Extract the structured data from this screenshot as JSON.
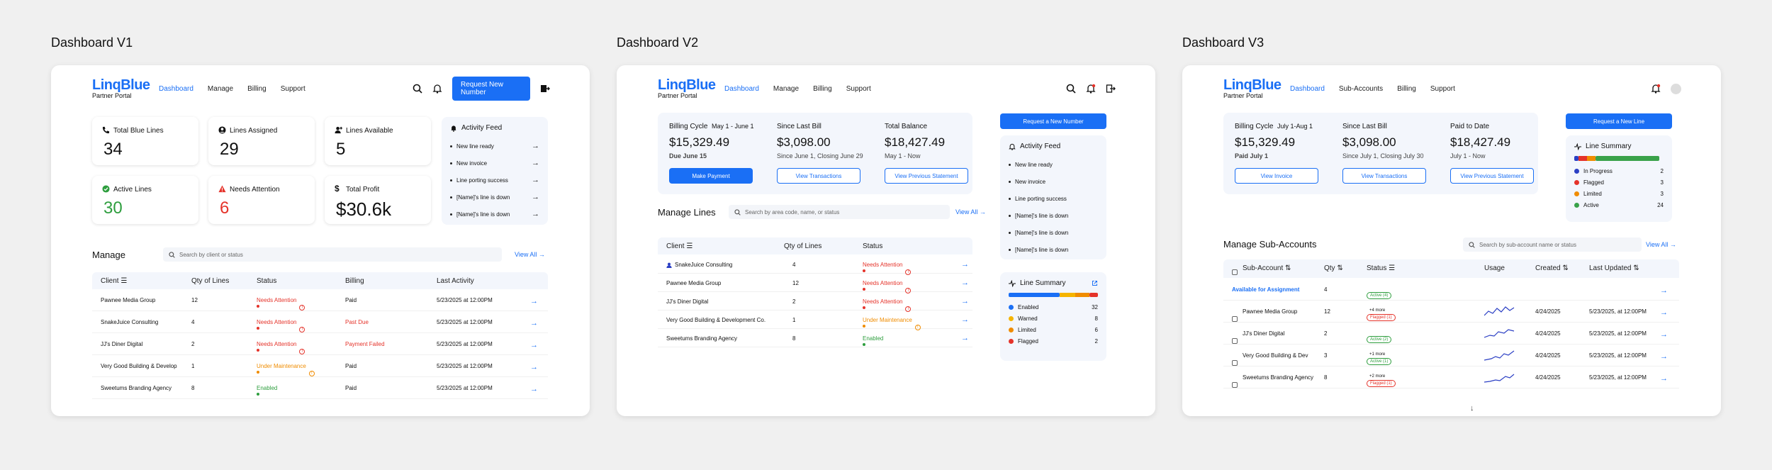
{
  "titles": [
    "Dashboard V1",
    "Dashboard V2",
    "Dashboard V3"
  ],
  "brand": {
    "name_a": "Linq",
    "name_b": "Blue",
    "subtitle": "Partner Portal"
  },
  "v1": {
    "nav": [
      "Dashboard",
      "Manage",
      "Billing",
      "Support"
    ],
    "request_button": "Request New Number",
    "stats": [
      {
        "label": "Total Blue Lines",
        "value": "34",
        "icon": "phone-icon"
      },
      {
        "label": "Lines Assigned",
        "value": "29",
        "icon": "user-icon"
      },
      {
        "label": "Lines Available",
        "value": "5",
        "icon": "user-plus-icon"
      },
      {
        "label": "Active Lines",
        "value": "30",
        "icon": "check-circle-icon"
      },
      {
        "label": "Needs Attention",
        "value": "6",
        "icon": "warning-icon"
      },
      {
        "label": "Total Profit",
        "value": "$30.6k",
        "icon": "dollar-icon"
      }
    ],
    "feed_title": "Activity Feed",
    "feed": [
      "New line ready",
      "New invoice",
      "Line porting success",
      "[Name]'s line is down",
      "[Name]'s line is down"
    ],
    "manage_title": "Manage",
    "search_placeholder": "Search by client or status",
    "view_all": "View All",
    "columns": [
      "Client",
      "Qty of Lines",
      "Status",
      "Billing",
      "Last Activity"
    ],
    "rows": [
      {
        "client": "Pawnee Media Group",
        "qty": "12",
        "status": "Needs Attention",
        "billing": "Paid",
        "last": "5/23/2025 at 12:00PM"
      },
      {
        "client": "SnakeJuice Consulting",
        "qty": "4",
        "status": "Needs Attention",
        "billing": "Past Due",
        "last": "5/23/2025 at 12:00PM"
      },
      {
        "client": "JJ's Diner Digital",
        "qty": "2",
        "status": "Needs Attention",
        "billing": "Payment Failed",
        "last": "5/23/2025 at 12:00PM"
      },
      {
        "client": "Very Good Building & Develop",
        "qty": "1",
        "status": "Under Maintenance",
        "billing": "Paid",
        "last": "5/23/2025 at 12:00PM"
      },
      {
        "client": "Sweetums Branding Agency",
        "qty": "8",
        "status": "Enabled",
        "billing": "Paid",
        "last": "5/23/2025 at 12:00PM"
      }
    ]
  },
  "v2": {
    "nav": [
      "Dashboard",
      "Manage",
      "Billing",
      "Support"
    ],
    "billing_cycle_label": "Billing Cycle",
    "billing_cycle_range": "May 1 - June 1",
    "billing_cycle_value": "$15,329.49",
    "due": "Due June 15",
    "since_last_label": "Since Last Bill",
    "since_last_value": "$3,098.00",
    "since_last_sub": "Since June 1, Closing June 29",
    "total_label": "Total Balance",
    "total_value": "$18,427.49",
    "total_sub": "May 1 - Now",
    "make_payment": "Make Payment",
    "view_transactions": "View Transactions",
    "view_statement": "View Previous Statement",
    "request_button": "Request a New Number",
    "feed_title": "Activity Feed",
    "feed": [
      "New line ready",
      "New invoice",
      "Line porting success",
      "[Name]'s line is down",
      "[Name]'s line is down",
      "[Name]'s line is down"
    ],
    "manage_title": "Manage Lines",
    "search_placeholder": "Search by area code, name, or status",
    "view_all": "View All",
    "columns": [
      "Client",
      "Qty of Lines",
      "Status"
    ],
    "rows": [
      {
        "client": "SnakeJuice Consulting",
        "qty": "4",
        "status": "Needs Attention"
      },
      {
        "client": "Pawnee Media Group",
        "qty": "12",
        "status": "Needs Attention"
      },
      {
        "client": "JJ's Diner Digital",
        "qty": "2",
        "status": "Needs Attention"
      },
      {
        "client": "Very Good Building & Development Co.",
        "qty": "1",
        "status": "Under Maintenance"
      },
      {
        "client": "Sweetums Branding Agency",
        "qty": "8",
        "status": "Enabled"
      }
    ],
    "summary_title": "Line Summary",
    "summary": [
      {
        "label": "Enabled",
        "count": "32",
        "color": "#1a6ff5"
      },
      {
        "label": "Warned",
        "count": "8",
        "color": "#f5b400"
      },
      {
        "label": "Limited",
        "count": "6",
        "color": "#f08c00"
      },
      {
        "label": "Flagged",
        "count": "2",
        "color": "#e5332a"
      }
    ]
  },
  "v3": {
    "nav": [
      "Dashboard",
      "Sub-Accounts",
      "Billing",
      "Support"
    ],
    "billing_cycle_label": "Billing Cycle",
    "billing_cycle_range": "July 1-Aug 1",
    "billing_cycle_value": "$15,329.49",
    "paid": "Paid July 1",
    "since_last_label": "Since Last Bill",
    "since_last_value": "$3,098.00",
    "since_last_sub": "Since July 1, Closing July 30",
    "paid_date_label": "Paid to Date",
    "paid_date_value": "$18,427.49",
    "paid_date_sub": "July 1 - Now",
    "view_invoice": "View Invoice",
    "view_transactions": "View Transactions",
    "view_statement": "View Previous Statement",
    "request_button": "Request a New Line",
    "summary_title": "Line Summary",
    "summary": [
      {
        "label": "In Progress",
        "count": "2",
        "color": "#2b3fc4"
      },
      {
        "label": "Flagged",
        "count": "3",
        "color": "#e5332a"
      },
      {
        "label": "Limited",
        "count": "3",
        "color": "#f08c00"
      },
      {
        "label": "Active",
        "count": "24",
        "color": "#3aa24a"
      }
    ],
    "manage_title": "Manage Sub-Accounts",
    "search_placeholder": "Search by sub-account name or status",
    "view_all": "View All",
    "columns": [
      "Sub-Account",
      "Qty",
      "Status",
      "Usage",
      "Created",
      "Last Updated"
    ],
    "available": {
      "label": "Available for Assignment",
      "qty": "4",
      "status": "Active (4)"
    },
    "rows": [
      {
        "client": "Pawnee Media Group",
        "qty": "12",
        "status": "Flagged (1)",
        "more": "+4 more",
        "created": "4/24/2025",
        "updated": "5/23/2025, at 12:00PM"
      },
      {
        "client": "JJ's Diner Digital",
        "qty": "2",
        "status": "Active (2)",
        "more": "",
        "created": "4/24/2025",
        "updated": "5/23/2025, at 12:00PM"
      },
      {
        "client": "Very Good Building & Dev",
        "qty": "3",
        "status": "Active (1)",
        "more": "+1 more",
        "created": "4/24/2025",
        "updated": "5/23/2025, at 12:00PM"
      },
      {
        "client": "Sweetums Branding Agency",
        "qty": "8",
        "status": "Flagged (1)",
        "more": "+2 more",
        "created": "4/24/2025",
        "updated": "5/23/2025, at 12:00PM"
      }
    ]
  }
}
